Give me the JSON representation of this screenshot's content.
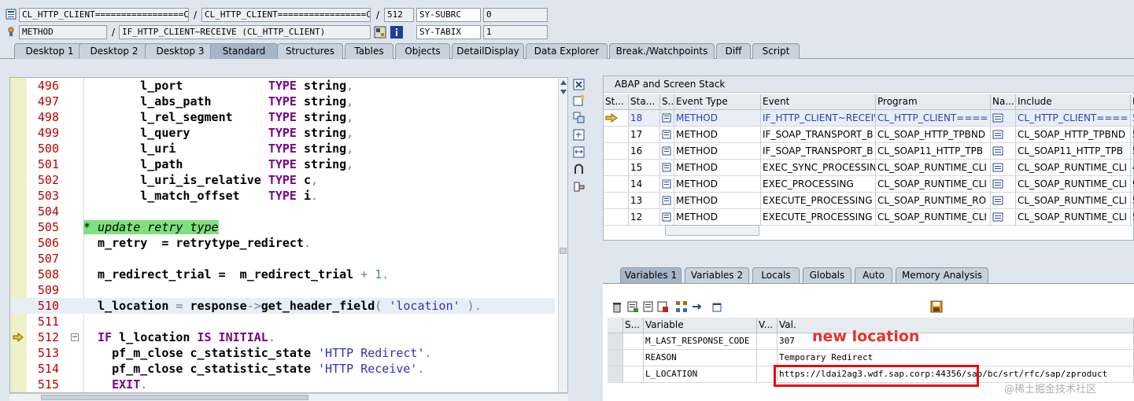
{
  "header": {
    "row1": {
      "class_name": "CL_HTTP_CLIENT=================CP",
      "program": "CL_HTTP_CLIENT=================CM",
      "line": "512",
      "sysvar": "SY-SUBRC",
      "sysval": "0"
    },
    "row2": {
      "type": "METHOD",
      "event": "IF_HTTP_CLIENT~RECEIVE (CL_HTTP_CLIENT)",
      "sysvar": "SY-TABIX",
      "sysval": "1"
    }
  },
  "tabs": [
    "Desktop 1",
    "Desktop 2",
    "Desktop 3",
    "Standard",
    "Structures",
    "Tables",
    "Objects",
    "DetailDisplay",
    "Data Explorer",
    "Break./Watchpoints",
    "Diff",
    "Script"
  ],
  "code": {
    "lines": [
      {
        "n": "496",
        "parts": [
          [
            "id",
            "        l_port            "
          ],
          [
            "ty",
            "TYPE"
          ],
          [
            "id",
            " string"
          ],
          [
            "op",
            ","
          ]
        ]
      },
      {
        "n": "497",
        "parts": [
          [
            "id",
            "        l_abs_path        "
          ],
          [
            "ty",
            "TYPE"
          ],
          [
            "id",
            " string"
          ],
          [
            "op",
            ","
          ]
        ]
      },
      {
        "n": "498",
        "parts": [
          [
            "id",
            "        l_rel_segment     "
          ],
          [
            "ty",
            "TYPE"
          ],
          [
            "id",
            " string"
          ],
          [
            "op",
            ","
          ]
        ]
      },
      {
        "n": "499",
        "parts": [
          [
            "id",
            "        l_query           "
          ],
          [
            "ty",
            "TYPE"
          ],
          [
            "id",
            " string"
          ],
          [
            "op",
            ","
          ]
        ]
      },
      {
        "n": "500",
        "parts": [
          [
            "id",
            "        l_uri             "
          ],
          [
            "ty",
            "TYPE"
          ],
          [
            "id",
            " string"
          ],
          [
            "op",
            ","
          ]
        ]
      },
      {
        "n": "501",
        "parts": [
          [
            "id",
            "        l_path            "
          ],
          [
            "ty",
            "TYPE"
          ],
          [
            "id",
            " string"
          ],
          [
            "op",
            ","
          ]
        ]
      },
      {
        "n": "502",
        "parts": [
          [
            "id",
            "        l_uri_is_relative "
          ],
          [
            "ty",
            "TYPE"
          ],
          [
            "id",
            " c"
          ],
          [
            "op",
            ","
          ]
        ]
      },
      {
        "n": "503",
        "parts": [
          [
            "id",
            "        l_match_offset    "
          ],
          [
            "ty",
            "TYPE"
          ],
          [
            "id",
            " i"
          ],
          [
            "op",
            "."
          ]
        ]
      },
      {
        "n": "504",
        "parts": []
      },
      {
        "n": "505",
        "parts": [
          [
            "cmt",
            "* update retry type"
          ]
        ]
      },
      {
        "n": "506",
        "parts": [
          [
            "id",
            "  m_retry  = retrytype_redirect"
          ],
          [
            "op",
            "."
          ]
        ]
      },
      {
        "n": "507",
        "parts": []
      },
      {
        "n": "508",
        "parts": [
          [
            "id",
            "  m_redirect_trial =  m_redirect_trial "
          ],
          [
            "op",
            "+ "
          ],
          [
            "num",
            "1"
          ],
          [
            "op",
            "."
          ]
        ]
      },
      {
        "n": "509",
        "parts": []
      },
      {
        "n": "510",
        "parts": [
          [
            "id",
            "  l_location "
          ],
          [
            "op",
            "= "
          ],
          [
            "id",
            "response"
          ],
          [
            "op",
            "->"
          ],
          [
            "id",
            "get_header_field"
          ],
          [
            "op",
            "( "
          ],
          [
            "str",
            "'location'"
          ],
          [
            "op",
            " )."
          ]
        ],
        "hl": true
      },
      {
        "n": "511",
        "parts": []
      },
      {
        "n": "512",
        "parts": [
          [
            "kw",
            "  IF "
          ],
          [
            "id",
            "l_location "
          ],
          [
            "kw",
            "IS INITIAL"
          ],
          [
            "op",
            "."
          ]
        ],
        "current": true
      },
      {
        "n": "513",
        "parts": [
          [
            "id",
            "    pf_m_close c_statistic_state "
          ],
          [
            "str",
            "'HTTP Redirect'"
          ],
          [
            "op",
            "."
          ]
        ]
      },
      {
        "n": "514",
        "parts": [
          [
            "id",
            "    pf_m_close c_statistic_state "
          ],
          [
            "str",
            "'HTTP Receive'"
          ],
          [
            "op",
            "."
          ]
        ]
      },
      {
        "n": "515",
        "parts": [
          [
            "kw",
            "    EXIT"
          ],
          [
            "op",
            "."
          ]
        ]
      }
    ]
  },
  "stack": {
    "title": "ABAP and Screen Stack",
    "columns": [
      "St...",
      "Sta...",
      "S...",
      "Event Type",
      "Event",
      "Program",
      "Na...",
      "Include",
      "L"
    ],
    "rows": [
      {
        "level": "18",
        "type": "METHOD",
        "event": "IF_HTTP_CLIENT~RECEIVE",
        "program": "CL_HTTP_CLIENT====",
        "include": "CL_HTTP_CLIENT====",
        "line": "5",
        "current": true
      },
      {
        "level": "17",
        "type": "METHOD",
        "event": "IF_SOAP_TRANSPORT_B",
        "program": "CL_SOAP_HTTP_TPBND",
        "include": "CL_SOAP_HTTP_TPBND",
        "line": "5"
      },
      {
        "level": "16",
        "type": "METHOD",
        "event": "IF_SOAP_TRANSPORT_B",
        "program": "CL_SOAP11_HTTP_TPB",
        "include": "CL_SOAP11_HTTP_TPB",
        "line": "5"
      },
      {
        "level": "15",
        "type": "METHOD",
        "event": "EXEC_SYNC_PROCESSING",
        "program": "CL_SOAP_RUNTIME_CLI",
        "include": "CL_SOAP_RUNTIME_CLI",
        "line": "4"
      },
      {
        "level": "14",
        "type": "METHOD",
        "event": "EXEC_PROCESSING",
        "program": "CL_SOAP_RUNTIME_CLI",
        "include": "CL_SOAP_RUNTIME_CLI",
        "line": "9"
      },
      {
        "level": "13",
        "type": "METHOD",
        "event": "EXECUTE_PROCESSING",
        "program": "CL_SOAP_RUNTIME_RO",
        "include": "CL_SOAP_RUNTIME_CLI",
        "line": "5"
      },
      {
        "level": "12",
        "type": "METHOD",
        "event": "EXECUTE_PROCESSING",
        "program": "CL_SOAP_RUNTIME_CLI",
        "include": "CL_SOAP_RUNTIME_CLI",
        "line": "5"
      }
    ]
  },
  "vartabs": [
    "Variables 1",
    "Variables 2",
    "Locals",
    "Globals",
    "Auto",
    "Memory Analysis"
  ],
  "variables": {
    "columns": [
      "S...",
      "Variable",
      "V...",
      "Val."
    ],
    "rows": [
      {
        "name": "M_LAST_RESPONSE_CODE",
        "value": "307"
      },
      {
        "name": "REASON",
        "value": "Temporary Redirect"
      },
      {
        "name": "L_LOCATION",
        "value": "https://ldai2ag3.wdf.sap.corp:44356/sap/bc/srt/rfc/sap/zproduct"
      }
    ]
  },
  "annotation": "new location",
  "watermark": "@稀土掘金技术社区",
  "colors": {
    "accent": "#e01010",
    "keyword": "#7a008a",
    "string": "#3030c0",
    "comment_bg": "#7fe07f",
    "line_number": "#c00000"
  }
}
